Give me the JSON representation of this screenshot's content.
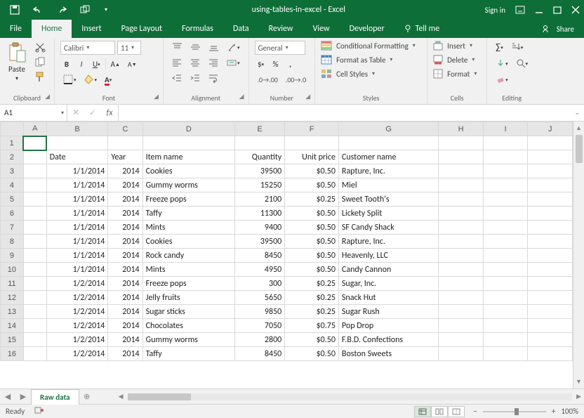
{
  "titlebar": {
    "title": "using-tables-in-excel - Excel",
    "signin": "Sign in"
  },
  "tabs": [
    "File",
    "Home",
    "Insert",
    "Page Layout",
    "Formulas",
    "Data",
    "Review",
    "View",
    "Developer"
  ],
  "active_tab": "Home",
  "tellme": "Tell me",
  "share": "Share",
  "ribbon": {
    "clipboard": {
      "paste": "Paste",
      "label": "Clipboard"
    },
    "font": {
      "name": "Calibri",
      "size": "11",
      "label": "Font"
    },
    "alignment": {
      "label": "Alignment"
    },
    "number": {
      "format": "General",
      "label": "Number"
    },
    "styles": {
      "cond": "Conditional Formatting",
      "table": "Format as Table",
      "cell": "Cell Styles",
      "label": "Styles"
    },
    "cells": {
      "insert": "Insert",
      "delete": "Delete",
      "format": "Format",
      "label": "Cells"
    },
    "editing": {
      "label": "Editing"
    }
  },
  "namebox": "A1",
  "columns": {
    "A": 30,
    "B": 80,
    "C": 45,
    "D": 120,
    "E": 65,
    "F": 70,
    "G": 130,
    "H": 58,
    "I": 58,
    "J": 58
  },
  "headers": {
    "B": "Date",
    "C": "Year",
    "D": "Item name",
    "E": "Quantity",
    "F": "Unit price",
    "G": "Customer name"
  },
  "rows": [
    {
      "n": 1
    },
    {
      "n": 2,
      "header": true
    },
    {
      "n": 3,
      "B": "1/1/2014",
      "C": "2014",
      "D": "Cookies",
      "E": "39500",
      "F": "$0.50",
      "G": "Rapture, Inc."
    },
    {
      "n": 4,
      "B": "1/1/2014",
      "C": "2014",
      "D": "Gummy worms",
      "E": "15250",
      "F": "$0.50",
      "G": "Miel"
    },
    {
      "n": 5,
      "B": "1/1/2014",
      "C": "2014",
      "D": "Freeze pops",
      "E": "2100",
      "F": "$0.25",
      "G": "Sweet Tooth's"
    },
    {
      "n": 6,
      "B": "1/1/2014",
      "C": "2014",
      "D": "Taffy",
      "E": "11300",
      "F": "$0.50",
      "G": "Lickety Split"
    },
    {
      "n": 7,
      "B": "1/1/2014",
      "C": "2014",
      "D": "Mints",
      "E": "9400",
      "F": "$0.50",
      "G": "SF Candy Shack"
    },
    {
      "n": 8,
      "B": "1/1/2014",
      "C": "2014",
      "D": "Cookies",
      "E": "39500",
      "F": "$0.50",
      "G": "Rapture, Inc."
    },
    {
      "n": 9,
      "B": "1/1/2014",
      "C": "2014",
      "D": "Rock candy",
      "E": "8450",
      "F": "$0.50",
      "G": "Heavenly, LLC"
    },
    {
      "n": 10,
      "B": "1/1/2014",
      "C": "2014",
      "D": "Mints",
      "E": "4950",
      "F": "$0.50",
      "G": "Candy Cannon"
    },
    {
      "n": 11,
      "B": "1/2/2014",
      "C": "2014",
      "D": "Freeze pops",
      "E": "300",
      "F": "$0.25",
      "G": "Sugar, Inc."
    },
    {
      "n": 12,
      "B": "1/2/2014",
      "C": "2014",
      "D": "Jelly fruits",
      "E": "5650",
      "F": "$0.25",
      "G": "Snack Hut"
    },
    {
      "n": 13,
      "B": "1/2/2014",
      "C": "2014",
      "D": "Sugar sticks",
      "E": "9850",
      "F": "$0.25",
      "G": "Sugar Rush"
    },
    {
      "n": 14,
      "B": "1/2/2014",
      "C": "2014",
      "D": "Chocolates",
      "E": "7050",
      "F": "$0.75",
      "G": "Pop Drop"
    },
    {
      "n": 15,
      "B": "1/2/2014",
      "C": "2014",
      "D": "Gummy worms",
      "E": "2800",
      "F": "$0.50",
      "G": "F.B.D. Confections"
    },
    {
      "n": 16,
      "B": "1/2/2014",
      "C": "2014",
      "D": "Taffy",
      "E": "8450",
      "F": "$0.50",
      "G": "Boston Sweets"
    }
  ],
  "sheet_tab": "Raw data",
  "status": {
    "ready": "Ready",
    "zoom": "100%"
  }
}
